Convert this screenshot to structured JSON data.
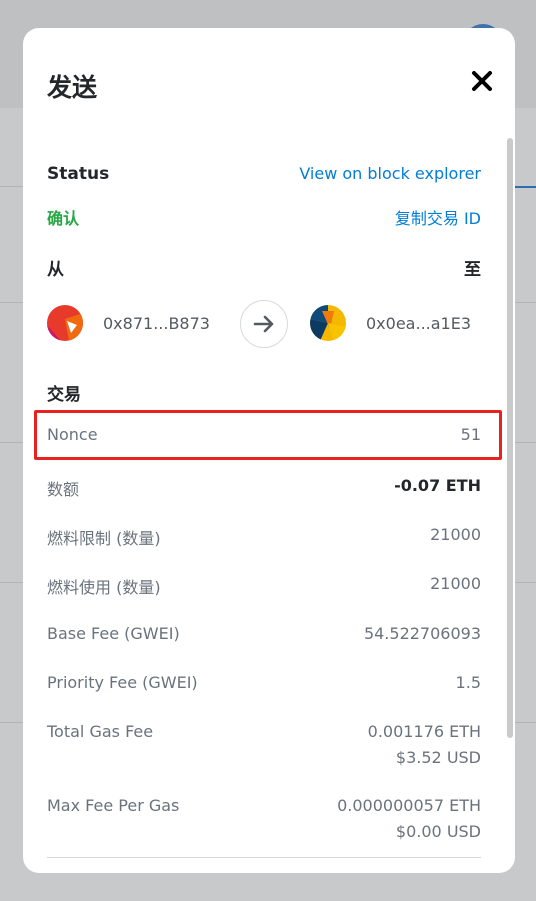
{
  "modal": {
    "title": "发送"
  },
  "status": {
    "label": "Status",
    "value": "确认",
    "explorer_link": "View on block explorer",
    "copy_link": "复制交易 ID"
  },
  "transfer": {
    "from_label": "从",
    "to_label": "至",
    "from_address": "0x871...B873",
    "to_address": "0x0ea...a1E3"
  },
  "transaction": {
    "section_title": "交易",
    "rows": [
      {
        "label": "Nonce",
        "value": "51"
      },
      {
        "label": "数额",
        "value": "-0.07 ETH"
      },
      {
        "label": "燃料限制 (数量)",
        "value": "21000"
      },
      {
        "label": "燃料使用 (数量)",
        "value": "21000"
      },
      {
        "label": "Base Fee (GWEI)",
        "value": "54.522706093"
      },
      {
        "label": "Priority Fee (GWEI)",
        "value": "1.5"
      },
      {
        "label": "Total Gas Fee",
        "value": "0.001176 ETH",
        "value2": "$3.52 USD"
      },
      {
        "label": "Max Fee Per Gas",
        "value": "0.000000057 ETH",
        "value2": "$0.00 USD"
      }
    ]
  },
  "colors": {
    "link": "#037dd6",
    "success": "#28a745",
    "highlight": "#e8231f"
  },
  "icons": {
    "close": "close-icon",
    "arrow": "arrow-right-icon"
  }
}
